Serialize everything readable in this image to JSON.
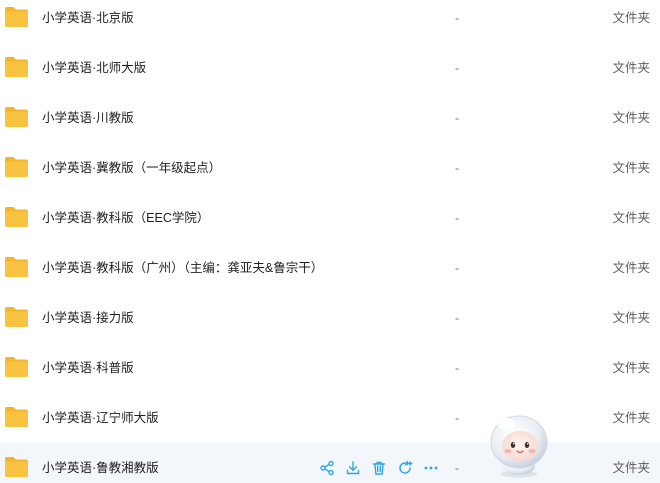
{
  "colors": {
    "folder": "#f8c340",
    "folder_tab": "#f5b52a",
    "action_icon": "#2fa5e6",
    "hover_bg": "#f3f6fb"
  },
  "rows": [
    {
      "name": "小学英语·北京版",
      "size": "-",
      "type": "文件夹"
    },
    {
      "name": "小学英语·北师大版",
      "size": "-",
      "type": "文件夹"
    },
    {
      "name": "小学英语·川教版",
      "size": "-",
      "type": "文件夹"
    },
    {
      "name": "小学英语·冀教版（一年级起点）",
      "size": "-",
      "type": "文件夹"
    },
    {
      "name": "小学英语·教科版（EEC学院）",
      "size": "-",
      "type": "文件夹"
    },
    {
      "name": "小学英语·教科版（广州）（主编：龚亚夫&鲁宗干）",
      "size": "-",
      "type": "文件夹"
    },
    {
      "name": "小学英语·接力版",
      "size": "-",
      "type": "文件夹"
    },
    {
      "name": "小学英语·科普版",
      "size": "-",
      "type": "文件夹"
    },
    {
      "name": "小学英语·辽宁师大版",
      "size": "-",
      "type": "文件夹"
    },
    {
      "name": "小学英语·鲁教湘教版",
      "size": "-",
      "type": "文件夹"
    }
  ],
  "hover_actions": [
    {
      "icon": "share-icon"
    },
    {
      "icon": "download-icon"
    },
    {
      "icon": "delete-icon"
    },
    {
      "icon": "sync-icon"
    },
    {
      "icon": "more-icon"
    }
  ],
  "mascot": {
    "icon": "mascot-assistant-icon"
  }
}
